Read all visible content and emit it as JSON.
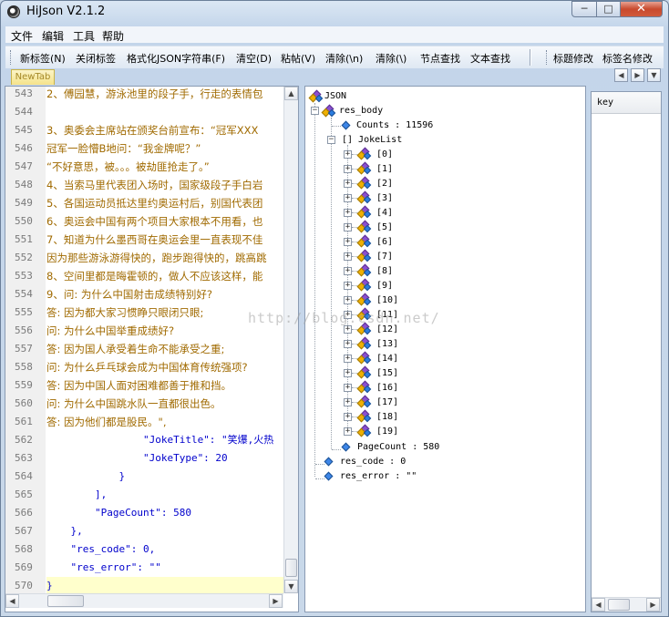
{
  "window": {
    "title": "HiJson V2.1.2",
    "min": "─",
    "max": "□",
    "close": "✕"
  },
  "menu": [
    "文件",
    "编辑",
    "工具",
    "帮助"
  ],
  "toolbar": [
    "新标签(N)",
    "关闭标签",
    "格式化JSON字符串(F)",
    "清空(D)",
    "粘帖(V)",
    "清除(\\n)",
    "清除(\\)",
    "节点查找",
    "文本查找",
    "标题修改",
    "标签名修改"
  ],
  "tab": {
    "label": "NewTab",
    "prev": "◀",
    "next": "▶",
    "menu": "▼"
  },
  "editor": {
    "lines": [
      {
        "n": "543",
        "t": "2、傅园慧，游泳池里的段子手，行走的表情包",
        "kind": "text"
      },
      {
        "n": "544",
        "t": "",
        "kind": "text"
      },
      {
        "n": "545",
        "t": "3、奥委会主席站在颁奖台前宣布：“冠军XXX",
        "kind": "text"
      },
      {
        "n": "546",
        "t": "冠军一脸懵B地问：“我金牌呢？”",
        "kind": "text"
      },
      {
        "n": "547",
        "t": "“不好意思，被。。。被劫匪抢走了。”",
        "kind": "text"
      },
      {
        "n": "548",
        "t": "4、当索马里代表团入场时，国家级段子手白岩",
        "kind": "text"
      },
      {
        "n": "549",
        "t": "5、各国运动员抵达里约奥运村后，别国代表团",
        "kind": "text"
      },
      {
        "n": "550",
        "t": "6、奥运会中国有两个项目大家根本不用看，也",
        "kind": "text"
      },
      {
        "n": "551",
        "t": "7、知道为什么墨西哥在奥运会里一直表现不佳",
        "kind": "text"
      },
      {
        "n": "552",
        "t": "因为那些游泳游得快的，跑步跑得快的，跳高跳",
        "kind": "text"
      },
      {
        "n": "553",
        "t": "8、空间里都是晦霍顿的，做人不应该这样，能",
        "kind": "text"
      },
      {
        "n": "554",
        "t": "9、问: 为什么中国射击成绩特别好?",
        "kind": "text"
      },
      {
        "n": "555",
        "t": "答: 因为都大家习惯睁只眼闭只眼;",
        "kind": "text"
      },
      {
        "n": "556",
        "t": "问: 为什么中国举重成绩好?",
        "kind": "text"
      },
      {
        "n": "557",
        "t": "答: 因为国人承受着生命不能承受之重;",
        "kind": "text"
      },
      {
        "n": "558",
        "t": "问: 为什么乒乓球会成为中国体育传统强项?",
        "kind": "text"
      },
      {
        "n": "559",
        "t": "答: 因为中国人面对困难都善于推和挡。",
        "kind": "text"
      },
      {
        "n": "560",
        "t": "问: 为什么中国跳水队一直都很出色。",
        "kind": "text"
      },
      {
        "n": "561",
        "t": "答: 因为他们都是股民。\",",
        "kind": "text"
      },
      {
        "n": "562",
        "t": "                \"JokeTitle\": \"笑爆,火热",
        "kind": "code"
      },
      {
        "n": "563",
        "t": "                \"JokeType\": 20",
        "kind": "code"
      },
      {
        "n": "564",
        "t": "            }",
        "kind": "code"
      },
      {
        "n": "565",
        "t": "        ],",
        "kind": "code"
      },
      {
        "n": "566",
        "t": "        \"PageCount\": 580",
        "kind": "code"
      },
      {
        "n": "567",
        "t": "    },",
        "kind": "code"
      },
      {
        "n": "568",
        "t": "    \"res_code\": 0,",
        "kind": "code"
      },
      {
        "n": "569",
        "t": "    \"res_error\": \"\"",
        "kind": "code"
      },
      {
        "n": "570",
        "t": "}",
        "kind": "code"
      }
    ]
  },
  "tree": {
    "root": "JSON",
    "res_body": "res_body",
    "counts": "Counts : 11596",
    "jokelist": "[] JokeList",
    "items": [
      "[0]",
      "[1]",
      "[2]",
      "[3]",
      "[4]",
      "[5]",
      "[6]",
      "[7]",
      "[8]",
      "[9]",
      "[10]",
      "[11]",
      "[12]",
      "[13]",
      "[14]",
      "[15]",
      "[16]",
      "[17]",
      "[18]",
      "[19]"
    ],
    "pagecount": "PageCount : 580",
    "res_code": "res_code : 0",
    "res_error": "res_error : \"\""
  },
  "key_panel": {
    "header": "key"
  },
  "watermark": "http://blog.csdn.net/",
  "colors": {
    "accent_tab": "#f5e38a",
    "close_button": "#c84a2e",
    "json_string": "#c04a00",
    "json_key": "#0000cc",
    "text_line": "#a06a00"
  }
}
